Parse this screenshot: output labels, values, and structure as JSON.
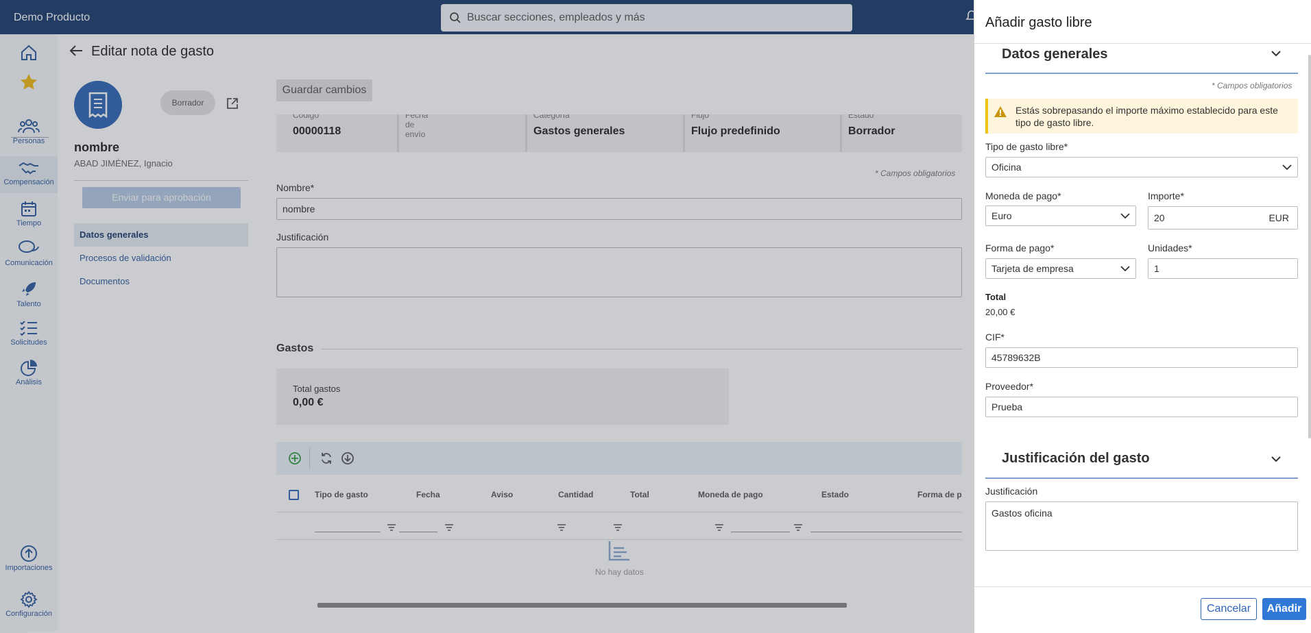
{
  "topbar": {
    "brand": "Demo Producto",
    "search_placeholder": "Buscar secciones, empleados y más"
  },
  "sidebar": {
    "items": [
      {
        "label": "",
        "icon": "home-icon"
      },
      {
        "label": "",
        "icon": "star-icon"
      },
      {
        "label": "Personas",
        "icon": "people-icon"
      },
      {
        "label": "Compensación",
        "icon": "handshake-icon"
      },
      {
        "label": "Tiempo",
        "icon": "calendar-icon"
      },
      {
        "label": "Comunicación",
        "icon": "chat-icon"
      },
      {
        "label": "Talento",
        "icon": "rocket-icon"
      },
      {
        "label": "Solicitudes",
        "icon": "checklist-icon"
      },
      {
        "label": "Análisis",
        "icon": "pie-icon"
      },
      {
        "label": "Importaciones",
        "icon": "upload-icon"
      },
      {
        "label": "Configuración",
        "icon": "gear-icon"
      }
    ]
  },
  "page": {
    "title": "Editar nota de gasto",
    "status_badge": "Borrador",
    "name": "nombre",
    "employee": "ABAD JIMÉNEZ, Ignacio",
    "send_button": "Enviar para aprobación",
    "subnav": [
      "Datos generales",
      "Procesos de validación",
      "Documentos"
    ],
    "save_button": "Guardar cambios",
    "info": [
      {
        "label": "Código",
        "value": "00000118"
      },
      {
        "label": "Fecha de envío",
        "value": ""
      },
      {
        "label": "Categoría",
        "value": "Gastos generales"
      },
      {
        "label": "Flujo",
        "value": "Flujo predefinido"
      },
      {
        "label": "Estado",
        "value": "Borrador"
      }
    ],
    "required_note": "* Campos obligatorios",
    "name_label": "Nombre*",
    "name_value": "nombre",
    "justification_label": "Justificación",
    "expenses_title": "Gastos",
    "total_label": "Total gastos",
    "total_value": "0,00 €",
    "grid_columns": [
      "Tipo de gasto",
      "Fecha",
      "Aviso",
      "Cantidad",
      "Total",
      "Moneda de pago",
      "Estado",
      "Forma de pa"
    ],
    "no_data": "No hay datos"
  },
  "panel": {
    "title": "Añadir gasto libre",
    "section1": "Datos generales",
    "required_note": "* Campos obligatorios",
    "warning": "Estás sobrepasando el importe máximo establecido para este tipo de gasto libre.",
    "tipo_label": "Tipo de gasto libre*",
    "tipo_value": "Oficina",
    "moneda_label": "Moneda de pago*",
    "moneda_value": "Euro",
    "importe_label": "Importe*",
    "importe_value": "20",
    "importe_unit": "EUR",
    "forma_label": "Forma de pago*",
    "forma_value": "Tarjeta de empresa",
    "unidades_label": "Unidades*",
    "unidades_value": "1",
    "total_label": "Total",
    "total_value": "20,00 €",
    "cif_label": "CIF*",
    "cif_value": "45789632B",
    "proveedor_label": "Proveedor*",
    "proveedor_value": "Prueba",
    "section2": "Justificación del gasto",
    "just_label": "Justificación",
    "just_value": "Gastos oficina",
    "cancel": "Cancelar",
    "add": "Añadir"
  },
  "colors": {
    "topbar": "#1b3a6b",
    "accent": "#2f64b6",
    "warning_bg": "#fdf6dc",
    "warning_border": "#f1c40f"
  }
}
